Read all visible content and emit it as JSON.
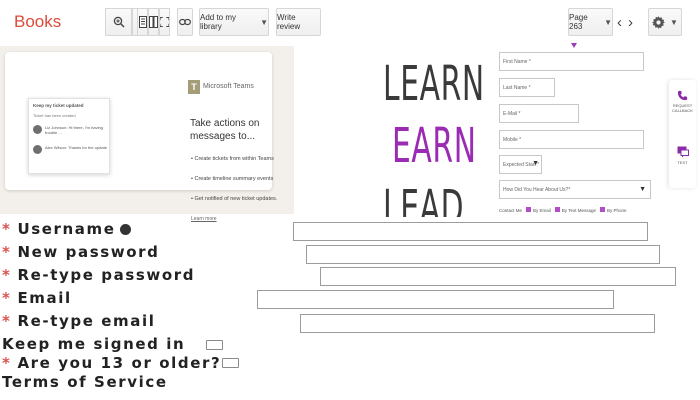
{
  "toolbar": {
    "brand": "Books",
    "add_library_label": "Add to my library",
    "write_review_label": "Write review",
    "page_label": "Page 263"
  },
  "teams_card": {
    "app_name": "Microsoft Teams",
    "heading": "Take actions on messages to...",
    "bullets": [
      "Create tickets from within Teams",
      "Create timeline summary events",
      "Get notified of new ticket updates."
    ],
    "learn_more": "Learn more",
    "mini_window": {
      "title": "Keep my ticket updated",
      "subtitle": "Ticket has been created",
      "rows": [
        "Liz Johnson: Hi there, I'm having trouble ...",
        "Alex Wilson: Thanks for the update"
      ]
    }
  },
  "slogan": {
    "words": [
      "LEARN",
      "EARN",
      "LEAD"
    ],
    "colors": [
      "#3a3a3a",
      "#9b2bb3",
      "#3a3a3a"
    ]
  },
  "lead_form": {
    "fields": [
      {
        "placeholder": "First Name *"
      },
      {
        "placeholder": "Last Name *"
      },
      {
        "placeholder": "E-Mail *"
      },
      {
        "placeholder": "Mobile *"
      },
      {
        "placeholder": "Expected Start *",
        "type": "select"
      },
      {
        "placeholder": "How Did You Hear About Us?*",
        "type": "select"
      }
    ],
    "contact_label": "Contact Me",
    "contact_options": [
      "By Email",
      "By Text Message",
      "By Phone"
    ],
    "accent": "#9b3dbf"
  },
  "side_actions": [
    {
      "icon": "phone-icon",
      "label": "REQUEST CALLBACK"
    },
    {
      "icon": "chat-icon",
      "label": "TEXT"
    }
  ],
  "registration": {
    "fields": [
      {
        "label": "Username",
        "required": true,
        "info_icon": true
      },
      {
        "label": "New password",
        "required": true
      },
      {
        "label": "Re-type password",
        "required": true
      },
      {
        "label": "Email",
        "required": true
      },
      {
        "label": "Re-type email",
        "required": true
      }
    ],
    "keep_signed_in": "Keep me signed in",
    "age_question": "Are you 13 or older?",
    "terms": "Terms of Service",
    "required_marker": "*"
  }
}
